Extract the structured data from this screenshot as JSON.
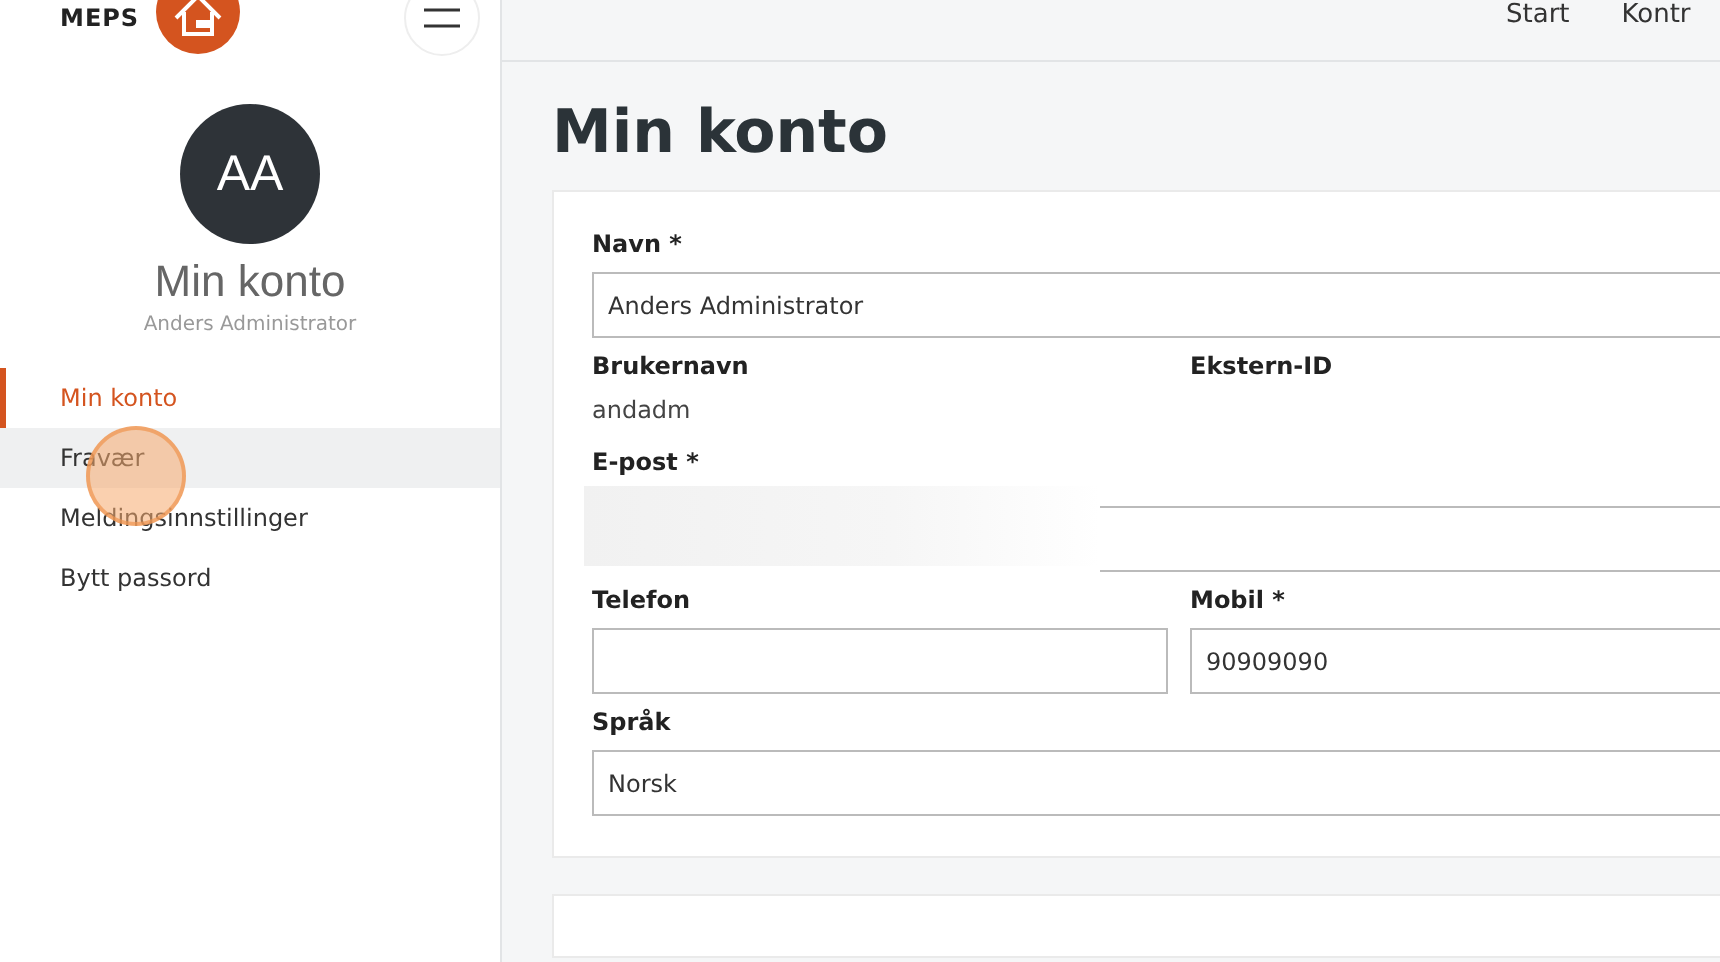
{
  "brand": {
    "name": "MEPS"
  },
  "top_nav": [
    {
      "label": "Start"
    },
    {
      "label": "Kontr"
    }
  ],
  "profile": {
    "initials": "AA",
    "title": "Min konto",
    "subtitle": "Anders Administrator"
  },
  "menu": [
    {
      "label": "Min konto",
      "selected": true,
      "hovered": false
    },
    {
      "label": "Fravær",
      "selected": false,
      "hovered": true
    },
    {
      "label": "Meldingsinnstillinger",
      "selected": false,
      "hovered": false
    },
    {
      "label": "Bytt passord",
      "selected": false,
      "hovered": false
    }
  ],
  "page_title": "Min konto",
  "form_rows": [
    [
      {
        "kind": "input",
        "label": "Navn *",
        "value": "Anders Administrator"
      }
    ],
    [
      {
        "kind": "text",
        "label": "Brukernavn",
        "value": "andadm"
      },
      {
        "kind": "text",
        "label": "Ekstern-ID"
      }
    ],
    [
      {
        "kind": "blurred",
        "label": "E-post *"
      }
    ],
    [
      {
        "kind": "input",
        "label": "Telefon"
      },
      {
        "kind": "input",
        "label": "Mobil *",
        "value": "90909090"
      }
    ],
    [
      {
        "kind": "input",
        "label": "Språk",
        "value": "Norsk"
      }
    ]
  ]
}
